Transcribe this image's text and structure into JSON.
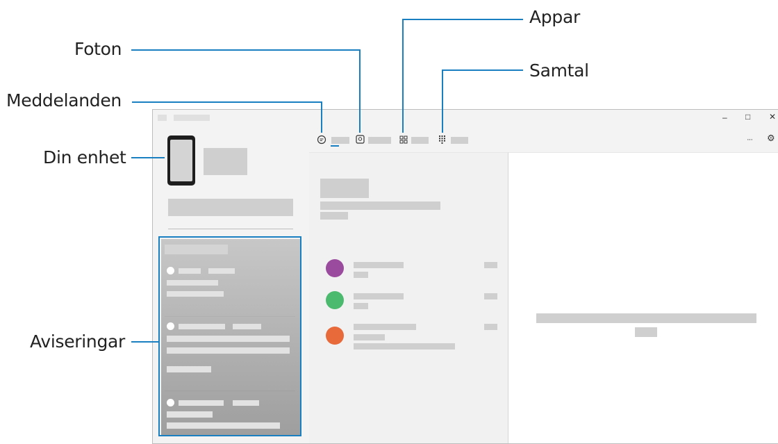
{
  "callouts": {
    "foton": "Foton",
    "meddelanden": "Meddelanden",
    "din_enhet": "Din enhet",
    "aviseringar": "Aviseringar",
    "appar": "Appar",
    "samtal": "Samtal"
  },
  "window_controls": {
    "minimize": "–",
    "maximize": "□",
    "close": "✕"
  },
  "toolbar": {
    "more": "···",
    "settings": "⚙"
  },
  "tab_icons": {
    "messages": "message-icon",
    "photos": "photo-icon",
    "apps": "apps-icon",
    "calls": "dialpad-icon"
  },
  "colors": {
    "callout_line": "#1a7fc1",
    "avatar_1": "#9b4b9e",
    "avatar_2": "#4cba6e",
    "avatar_3": "#e8693a"
  }
}
